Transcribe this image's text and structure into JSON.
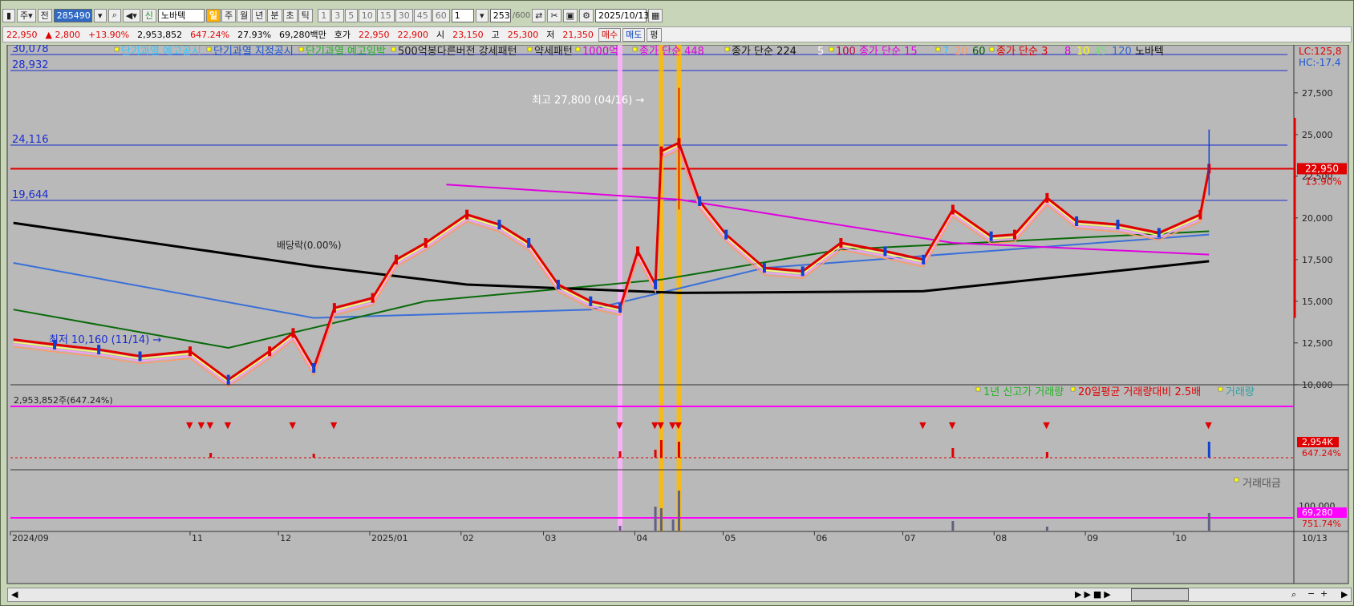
{
  "toolbar": {
    "market": "주",
    "prev": "전",
    "code": "285490",
    "name": "노바텍",
    "periods": [
      "일",
      "주",
      "월",
      "년",
      "분",
      "초",
      "틱"
    ],
    "active_period": "일",
    "minute_options": [
      "1",
      "3",
      "5",
      "10",
      "15",
      "30",
      "45",
      "60"
    ],
    "interval": "1",
    "bars": "253",
    "bars_total": "/600",
    "date": "2025/10/13"
  },
  "quote": {
    "price": "22,950",
    "change": "2,800",
    "change_pct": "+13.90%",
    "volume": "2,953,852",
    "volume_ratio": "647.24%",
    "turnover": "27.93%",
    "amount": "69,280백만",
    "bid_label": "호가",
    "bid": "22,950",
    "ask": "22,900",
    "open_label": "시",
    "open": "23,150",
    "high_label": "고",
    "high": "25,300",
    "low_label": "저",
    "low": "21,350",
    "buy": "매수",
    "sell": "매도",
    "flat": "평"
  },
  "legend": [
    {
      "text": "단기과열 예고공시",
      "color": "#33c7ff"
    },
    {
      "text": "단기과열 지정공시",
      "color": "#1a55d0"
    },
    {
      "text": "단기과열 예고임박",
      "color": "#22b422"
    },
    {
      "text": "500억봉다른버전 강세패턴",
      "color": "#222222"
    },
    {
      "text": "약세패턴",
      "color": "#222222"
    },
    {
      "text": "1000억",
      "color": "#e000e0"
    },
    {
      "text": "종가 단순 448",
      "color": "#e000e0"
    },
    {
      "text": "종가 단순 224",
      "color": "#111111"
    },
    {
      "text": "5",
      "color": "#ffffff"
    },
    {
      "text": "100",
      "color": "#c00050"
    },
    {
      "text": "종가 단순 15",
      "color": "#e000e0"
    },
    {
      "text": "7",
      "color": "#33c7ff"
    },
    {
      "text": "20",
      "color": "#ff9966"
    },
    {
      "text": "60",
      "color": "#006000"
    },
    {
      "text": "종가 단순 3",
      "color": "#e00000"
    },
    {
      "text": "8",
      "color": "#e000e0"
    },
    {
      "text": "10",
      "color": "#ffff00"
    },
    {
      "text": "45",
      "color": "#7fd57f"
    },
    {
      "text": "120",
      "color": "#3366cc"
    },
    {
      "text": "노바텍",
      "color": "#111111"
    }
  ],
  "top_right": {
    "lc": "LC:125,8",
    "hc": "HC:-17.4"
  },
  "levels": [
    {
      "label": "30,078"
    },
    {
      "label": "28,932"
    },
    {
      "label": "24,116"
    },
    {
      "label": "19,644"
    }
  ],
  "annotations": {
    "high": "최고 27,800 (04/16)",
    "low": "최저 10,160 (11/14)",
    "ex_rights": "배당락(0.00%)"
  },
  "price_tag": {
    "price": "22,950",
    "pct": "13.90%"
  },
  "vol_panel": {
    "header": "2,953,852주(647.24%)",
    "legend": [
      {
        "text": "1년 신고가 거래량",
        "color": "#22b422"
      },
      {
        "text": "20일평균 거래량대비 2.5배",
        "color": "#e00000"
      },
      {
        "text": "거래량",
        "color": "#2aa0a0"
      }
    ],
    "tag_value": "2,954K",
    "tag_pct": "647.24%"
  },
  "amt_panel": {
    "legend": "거래대금",
    "axis_label": "100,000",
    "tag_value": "69,280",
    "tag_pct": "751.74%"
  },
  "x_labels": [
    "2024/09",
    "11",
    "12",
    "2025/01",
    "02",
    "03",
    "04",
    "05",
    "06",
    "07",
    "08",
    "09",
    "10"
  ],
  "x_end_label": "10/13",
  "chart_data": {
    "type": "candlestick",
    "y_ticks": [
      10000,
      12500,
      15000,
      17500,
      20000,
      22500,
      25000,
      27500
    ],
    "ylim": [
      8500,
      29800
    ],
    "close_series": [
      [
        "2024-09-02",
        12700
      ],
      [
        "2024-09-16",
        12400
      ],
      [
        "2024-10-01",
        12100
      ],
      [
        "2024-10-15",
        11700
      ],
      [
        "2024-11-01",
        12000
      ],
      [
        "2024-11-14",
        10300
      ],
      [
        "2024-11-28",
        12000
      ],
      [
        "2024-12-06",
        13100
      ],
      [
        "2024-12-13",
        11000
      ],
      [
        "2024-12-20",
        14600
      ],
      [
        "2025-01-02",
        15200
      ],
      [
        "2025-01-10",
        17500
      ],
      [
        "2025-01-20",
        18500
      ],
      [
        "2025-02-03",
        20200
      ],
      [
        "2025-02-14",
        19600
      ],
      [
        "2025-02-24",
        18500
      ],
      [
        "2025-03-06",
        16000
      ],
      [
        "2025-03-17",
        15000
      ],
      [
        "2025-03-27",
        14600
      ],
      [
        "2025-04-02",
        18000
      ],
      [
        "2025-04-08",
        16000
      ],
      [
        "2025-04-10",
        24000
      ],
      [
        "2025-04-16",
        24500
      ],
      [
        "2025-04-23",
        21000
      ],
      [
        "2025-05-02",
        19000
      ],
      [
        "2025-05-15",
        17000
      ],
      [
        "2025-05-28",
        16800
      ],
      [
        "2025-06-10",
        18500
      ],
      [
        "2025-06-25",
        18000
      ],
      [
        "2025-07-08",
        17500
      ],
      [
        "2025-07-18",
        20500
      ],
      [
        "2025-07-31",
        18900
      ],
      [
        "2025-08-08",
        19000
      ],
      [
        "2025-08-19",
        21200
      ],
      [
        "2025-08-29",
        19800
      ],
      [
        "2025-09-12",
        19600
      ],
      [
        "2025-09-26",
        19100
      ],
      [
        "2025-10-10",
        20200
      ],
      [
        "2025-10-13",
        22950
      ]
    ],
    "ma_224": [
      [
        "2024-09-02",
        19700
      ],
      [
        "2024-12-13",
        17100
      ],
      [
        "2025-02-03",
        16000
      ],
      [
        "2025-04-16",
        15500
      ],
      [
        "2025-07-08",
        15600
      ],
      [
        "2025-10-13",
        17400
      ]
    ],
    "ma_448": [
      [
        "2025-01-27",
        22000
      ],
      [
        "2025-04-16",
        21100
      ],
      [
        "2025-07-18",
        18500
      ],
      [
        "2025-10-13",
        17800
      ]
    ],
    "ma_120": [
      [
        "2024-09-02",
        17300
      ],
      [
        "2024-12-13",
        14000
      ],
      [
        "2025-03-17",
        14500
      ],
      [
        "2025-05-15",
        17000
      ],
      [
        "2025-10-13",
        19000
      ]
    ],
    "ma_60": [
      [
        "2024-09-02",
        14500
      ],
      [
        "2024-11-14",
        12200
      ],
      [
        "2025-01-20",
        15000
      ],
      [
        "2025-04-10",
        16300
      ],
      [
        "2025-06-10",
        18100
      ],
      [
        "2025-10-13",
        19200
      ]
    ]
  }
}
